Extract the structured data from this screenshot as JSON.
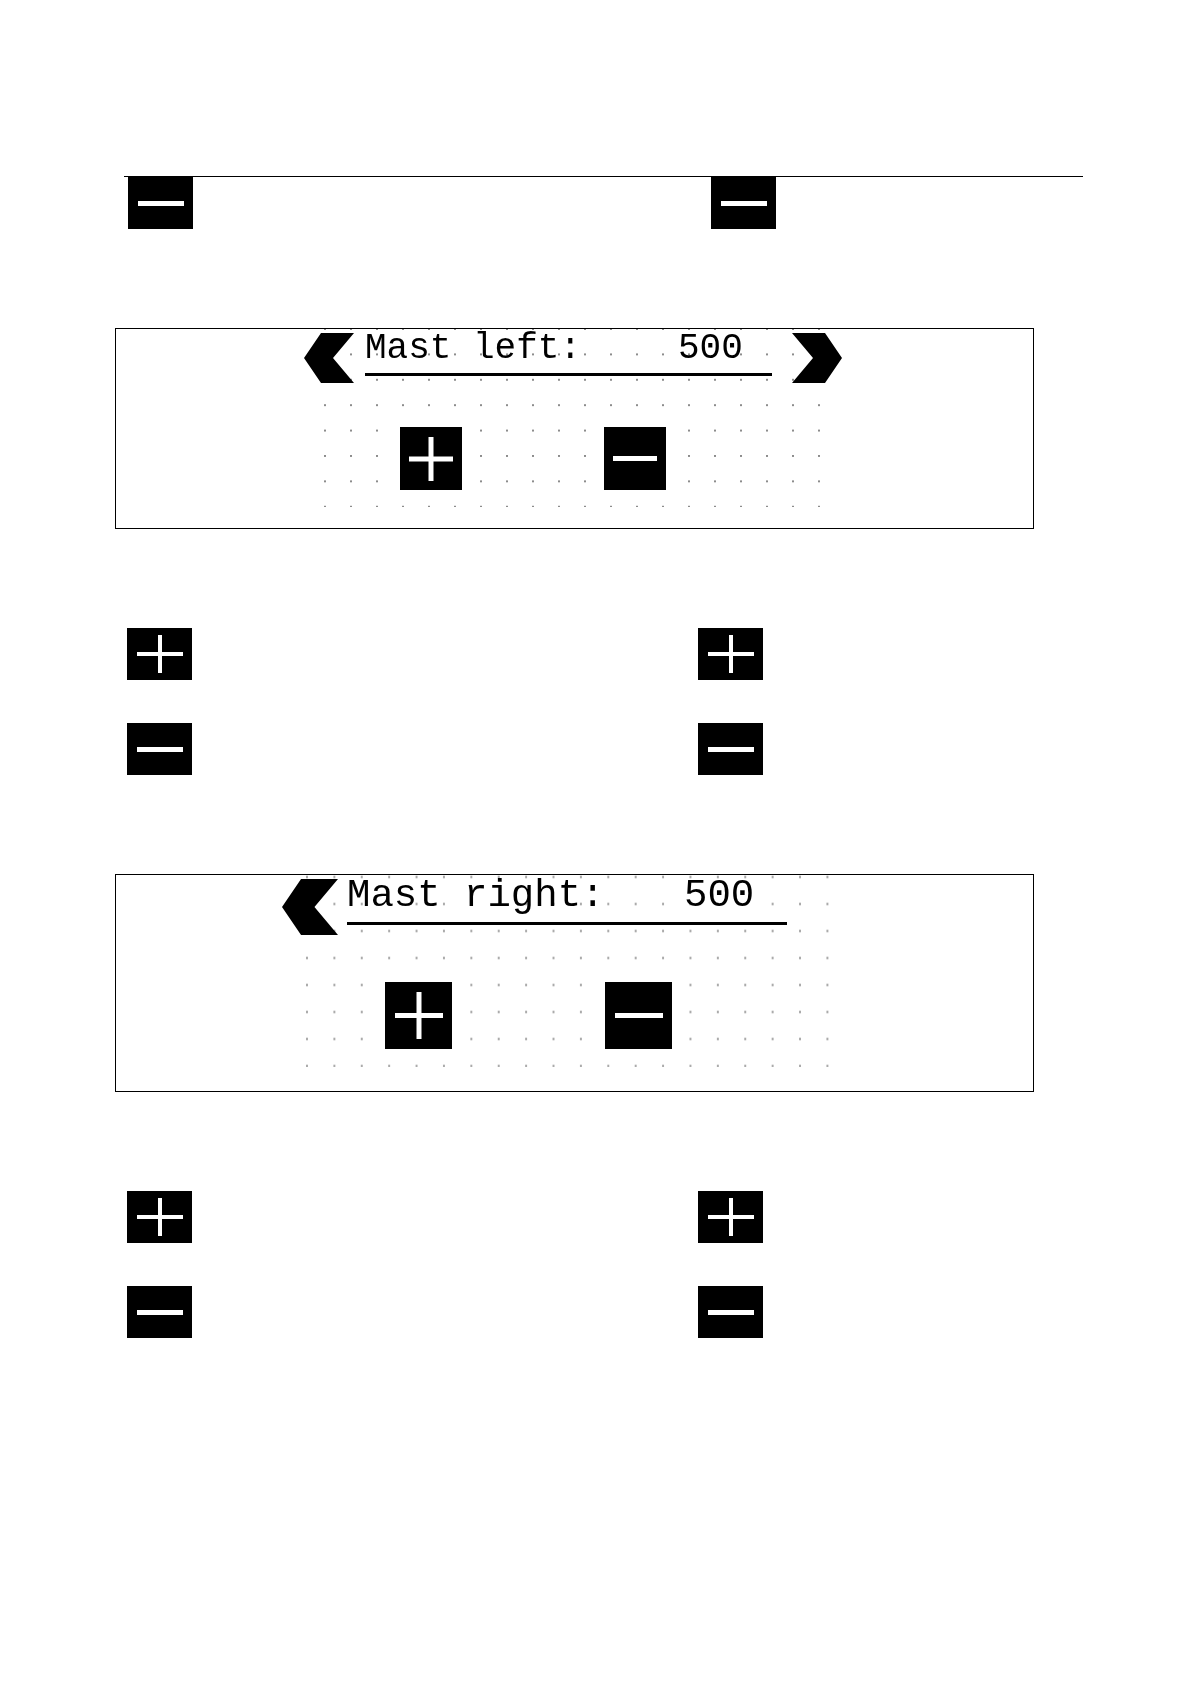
{
  "sections": [
    {
      "kind": "button_grid",
      "top_rule": true,
      "rows": [
        [
          {
            "kind": "minus"
          },
          {
            "kind": "minus"
          }
        ]
      ]
    },
    {
      "kind": "screen",
      "label": "Mast left:",
      "value": "500",
      "back_arrow": true,
      "forward_arrow": true,
      "buttons": [
        {
          "kind": "plus"
        },
        {
          "kind": "minus"
        }
      ]
    },
    {
      "kind": "button_grid",
      "top_rule": false,
      "rows": [
        [
          {
            "kind": "plus"
          },
          {
            "kind": "plus"
          }
        ],
        [
          {
            "kind": "minus"
          },
          {
            "kind": "minus"
          }
        ]
      ]
    },
    {
      "kind": "screen",
      "label": "Mast right:",
      "value": "500",
      "back_arrow": true,
      "forward_arrow": false,
      "buttons": [
        {
          "kind": "plus"
        },
        {
          "kind": "minus"
        }
      ]
    },
    {
      "kind": "button_grid",
      "top_rule": false,
      "rows": [
        [
          {
            "kind": "plus"
          },
          {
            "kind": "plus"
          }
        ],
        [
          {
            "kind": "minus"
          },
          {
            "kind": "minus"
          }
        ]
      ]
    }
  ]
}
